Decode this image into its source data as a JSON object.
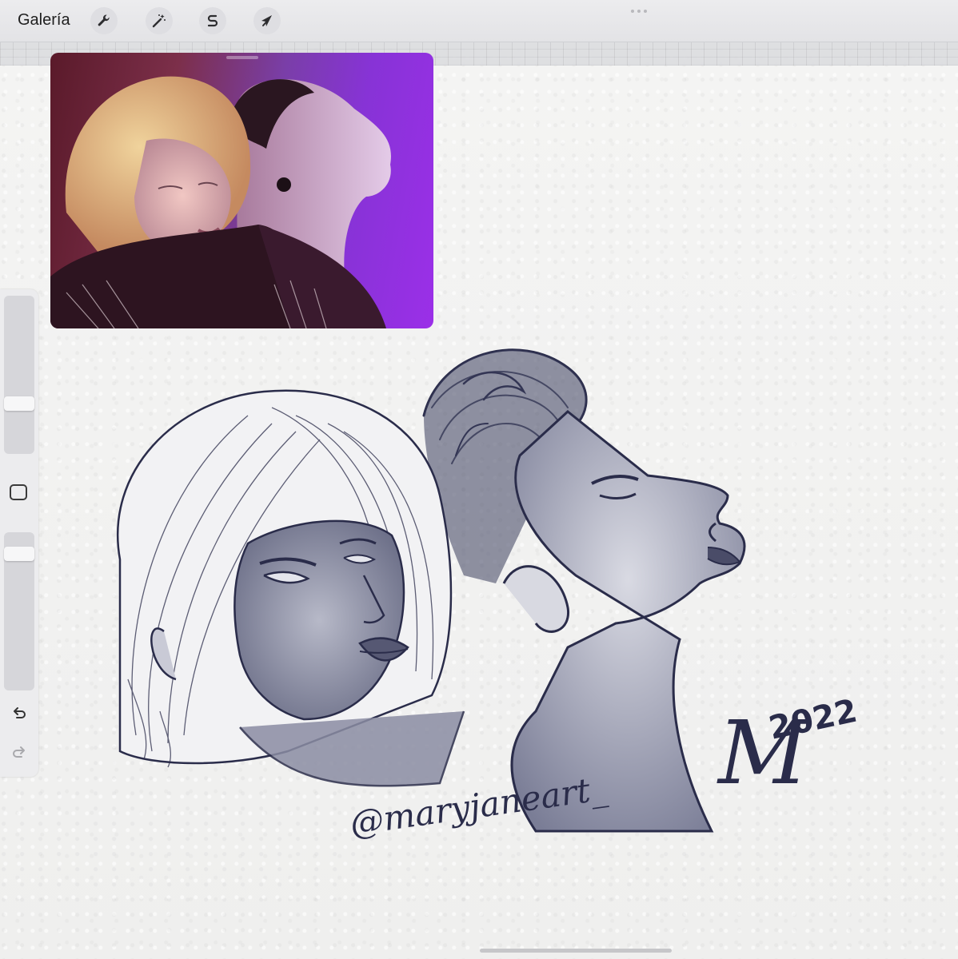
{
  "topbar": {
    "gallery_label": "Galería",
    "tools": [
      {
        "name": "actions",
        "icon": "wrench-icon"
      },
      {
        "name": "adjustments",
        "icon": "magic-wand-icon"
      },
      {
        "name": "selection",
        "icon": "selection-s-icon"
      },
      {
        "name": "transform",
        "icon": "arrow-cursor-icon"
      }
    ]
  },
  "reference_window": {
    "icon": "reference-photo"
  },
  "sidebar": {
    "brush_size": 0.3,
    "opacity": 0.9,
    "modify_icon": "square-icon",
    "undo_icon": "undo-icon",
    "redo_icon": "redo-icon"
  },
  "artwork": {
    "signature_letter": "M",
    "year": "2022",
    "watermark": "@maryjaneart_"
  },
  "colors": {
    "ink": "#2a2c4a",
    "paper": "#f3f2f1",
    "toolbar": "#e6e6e9"
  }
}
